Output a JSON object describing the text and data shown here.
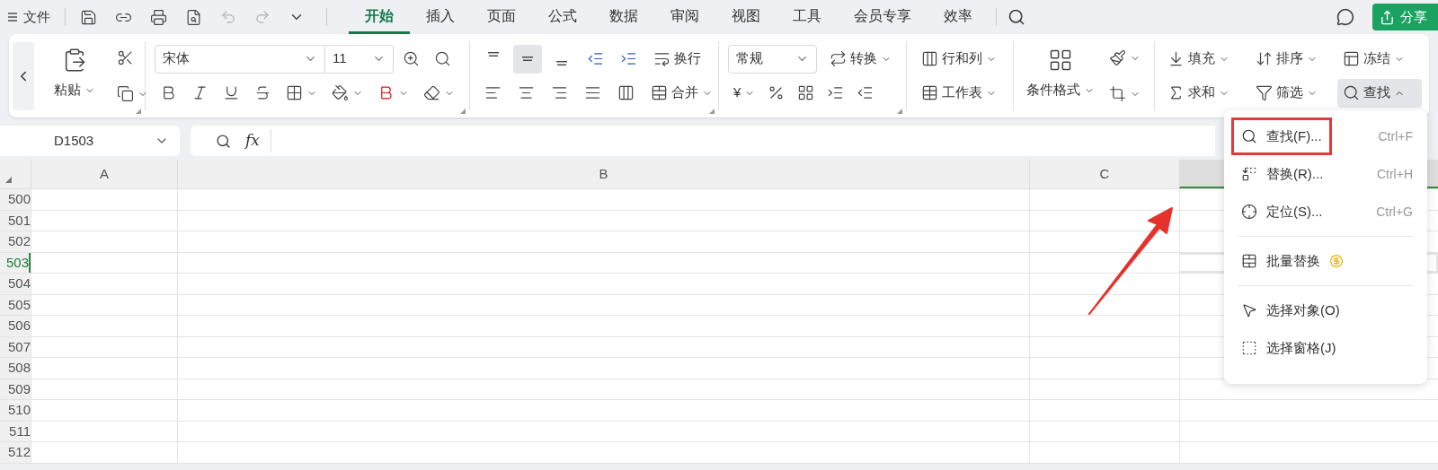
{
  "menu_bar": {
    "file": "文件",
    "tabs": [
      {
        "label": "开始",
        "selected": true
      },
      {
        "label": "插入",
        "selected": false
      },
      {
        "label": "页面",
        "selected": false
      },
      {
        "label": "公式",
        "selected": false
      },
      {
        "label": "数据",
        "selected": false
      },
      {
        "label": "审阅",
        "selected": false
      },
      {
        "label": "视图",
        "selected": false
      },
      {
        "label": "工具",
        "selected": false
      },
      {
        "label": "会员专享",
        "selected": false
      },
      {
        "label": "效率",
        "selected": false
      }
    ],
    "share_button": "分享"
  },
  "ribbon": {
    "paste": "粘贴",
    "font_name": "宋体",
    "font_size": "11",
    "vertical_align": [
      {
        "kind": "top",
        "selected": false
      },
      {
        "kind": "middle",
        "selected": true
      },
      {
        "kind": "bottom",
        "selected": false
      }
    ],
    "wrap": "换行",
    "merge": "合并",
    "number_format": "常规",
    "convert": "转换",
    "currency": "¥",
    "rows_cols": "行和列",
    "worksheet": "工作表",
    "conditional_format": "条件格式",
    "fill": "填充",
    "sort": "排序",
    "freeze": "冻结",
    "sum": "求和",
    "filter": "筛选",
    "find": "查找"
  },
  "formula_bar": {
    "cell_ref": "D1503",
    "fx": "fx"
  },
  "sheet": {
    "columns": [
      {
        "label": "A",
        "selected": false
      },
      {
        "label": "B",
        "selected": false
      },
      {
        "label": "C",
        "selected": false
      },
      {
        "selected": true
      }
    ],
    "rows": [
      {
        "number": "500",
        "selected": false
      },
      {
        "number": "501",
        "selected": false
      },
      {
        "number": "502",
        "selected": false
      },
      {
        "number": "503",
        "selected": true
      },
      {
        "number": "504",
        "selected": false
      },
      {
        "number": "505",
        "selected": false
      },
      {
        "number": "506",
        "selected": false
      },
      {
        "number": "507",
        "selected": false
      },
      {
        "number": "508",
        "selected": false
      },
      {
        "number": "509",
        "selected": false
      },
      {
        "number": "510",
        "selected": false
      },
      {
        "number": "511",
        "selected": false
      },
      {
        "number": "512",
        "selected": false
      }
    ]
  },
  "find_menu": {
    "items": [
      {
        "kind": "find",
        "label": "查找(F)...",
        "shortcut": "Ctrl+F",
        "highlighted": true,
        "separator_before": false
      },
      {
        "kind": "replace",
        "label": "替换(R)...",
        "shortcut": "Ctrl+H",
        "highlighted": false,
        "separator_before": false
      },
      {
        "kind": "goto",
        "label": "定位(S)...",
        "shortcut": "Ctrl+G",
        "highlighted": false,
        "separator_before": false
      },
      {
        "kind": "batch",
        "label": "批量替换",
        "highlighted": false,
        "separator_before": true
      },
      {
        "kind": "select_object",
        "label": "选择对象(O)",
        "highlighted": false,
        "separator_before": true
      },
      {
        "kind": "selection_pane",
        "label": "选择窗格(J)",
        "highlighted": false,
        "separator_before": false
      }
    ]
  }
}
